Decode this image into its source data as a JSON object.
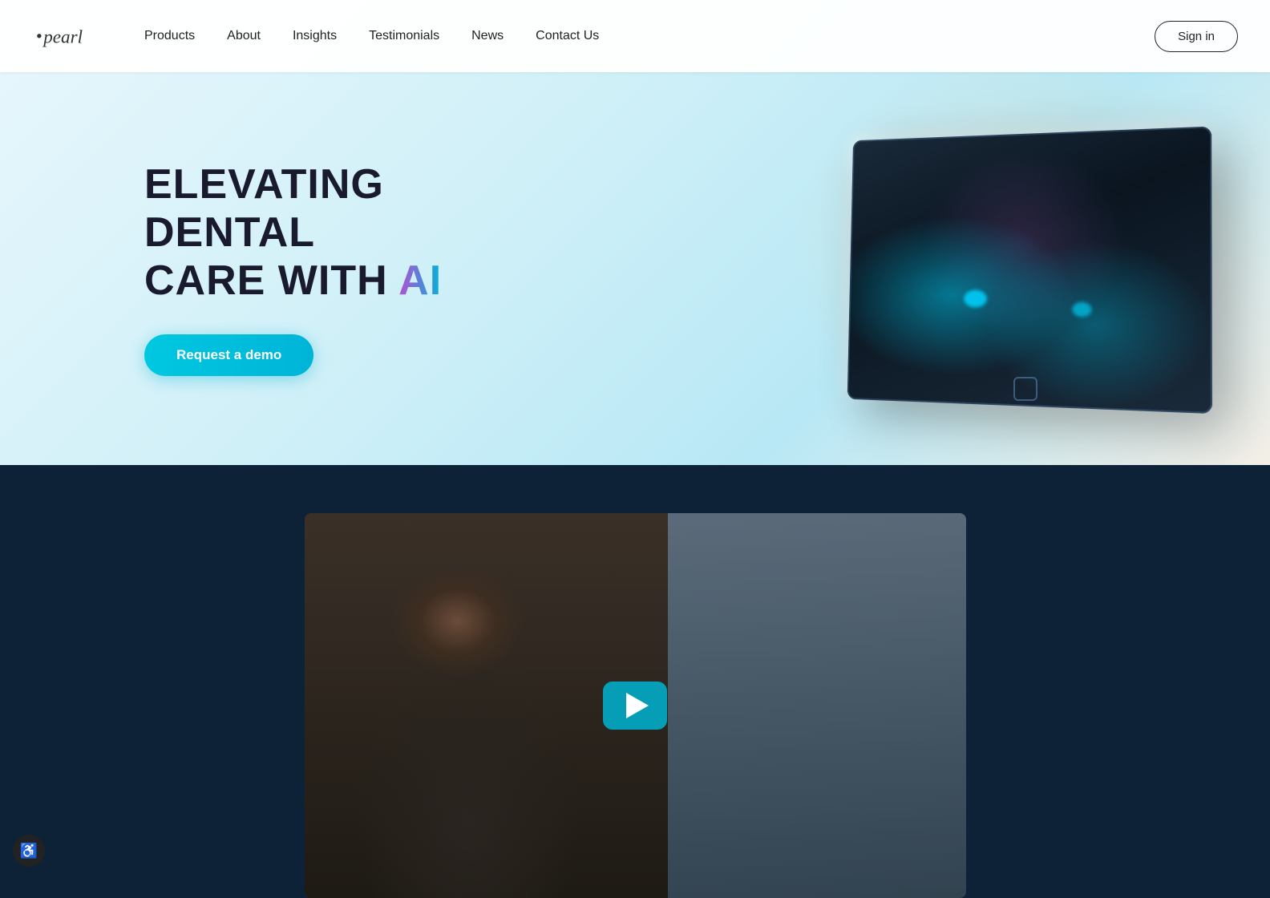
{
  "brand": {
    "name": "Pearl",
    "logo_text": "pearl"
  },
  "navbar": {
    "links": [
      {
        "id": "products",
        "label": "Products"
      },
      {
        "id": "about",
        "label": "About"
      },
      {
        "id": "insights",
        "label": "Insights"
      },
      {
        "id": "testimonials",
        "label": "Testimonials"
      },
      {
        "id": "news",
        "label": "News"
      },
      {
        "id": "contact",
        "label": "Contact Us"
      }
    ],
    "signin_label": "Sign in"
  },
  "hero": {
    "headline_part1": "ELEVATING DENTAL",
    "headline_part2": "CARE WITH ",
    "headline_ai": "AI",
    "cta_label": "Request a demo"
  },
  "video": {
    "play_label": "Play video"
  },
  "accessibility": {
    "button_label": "♿"
  }
}
